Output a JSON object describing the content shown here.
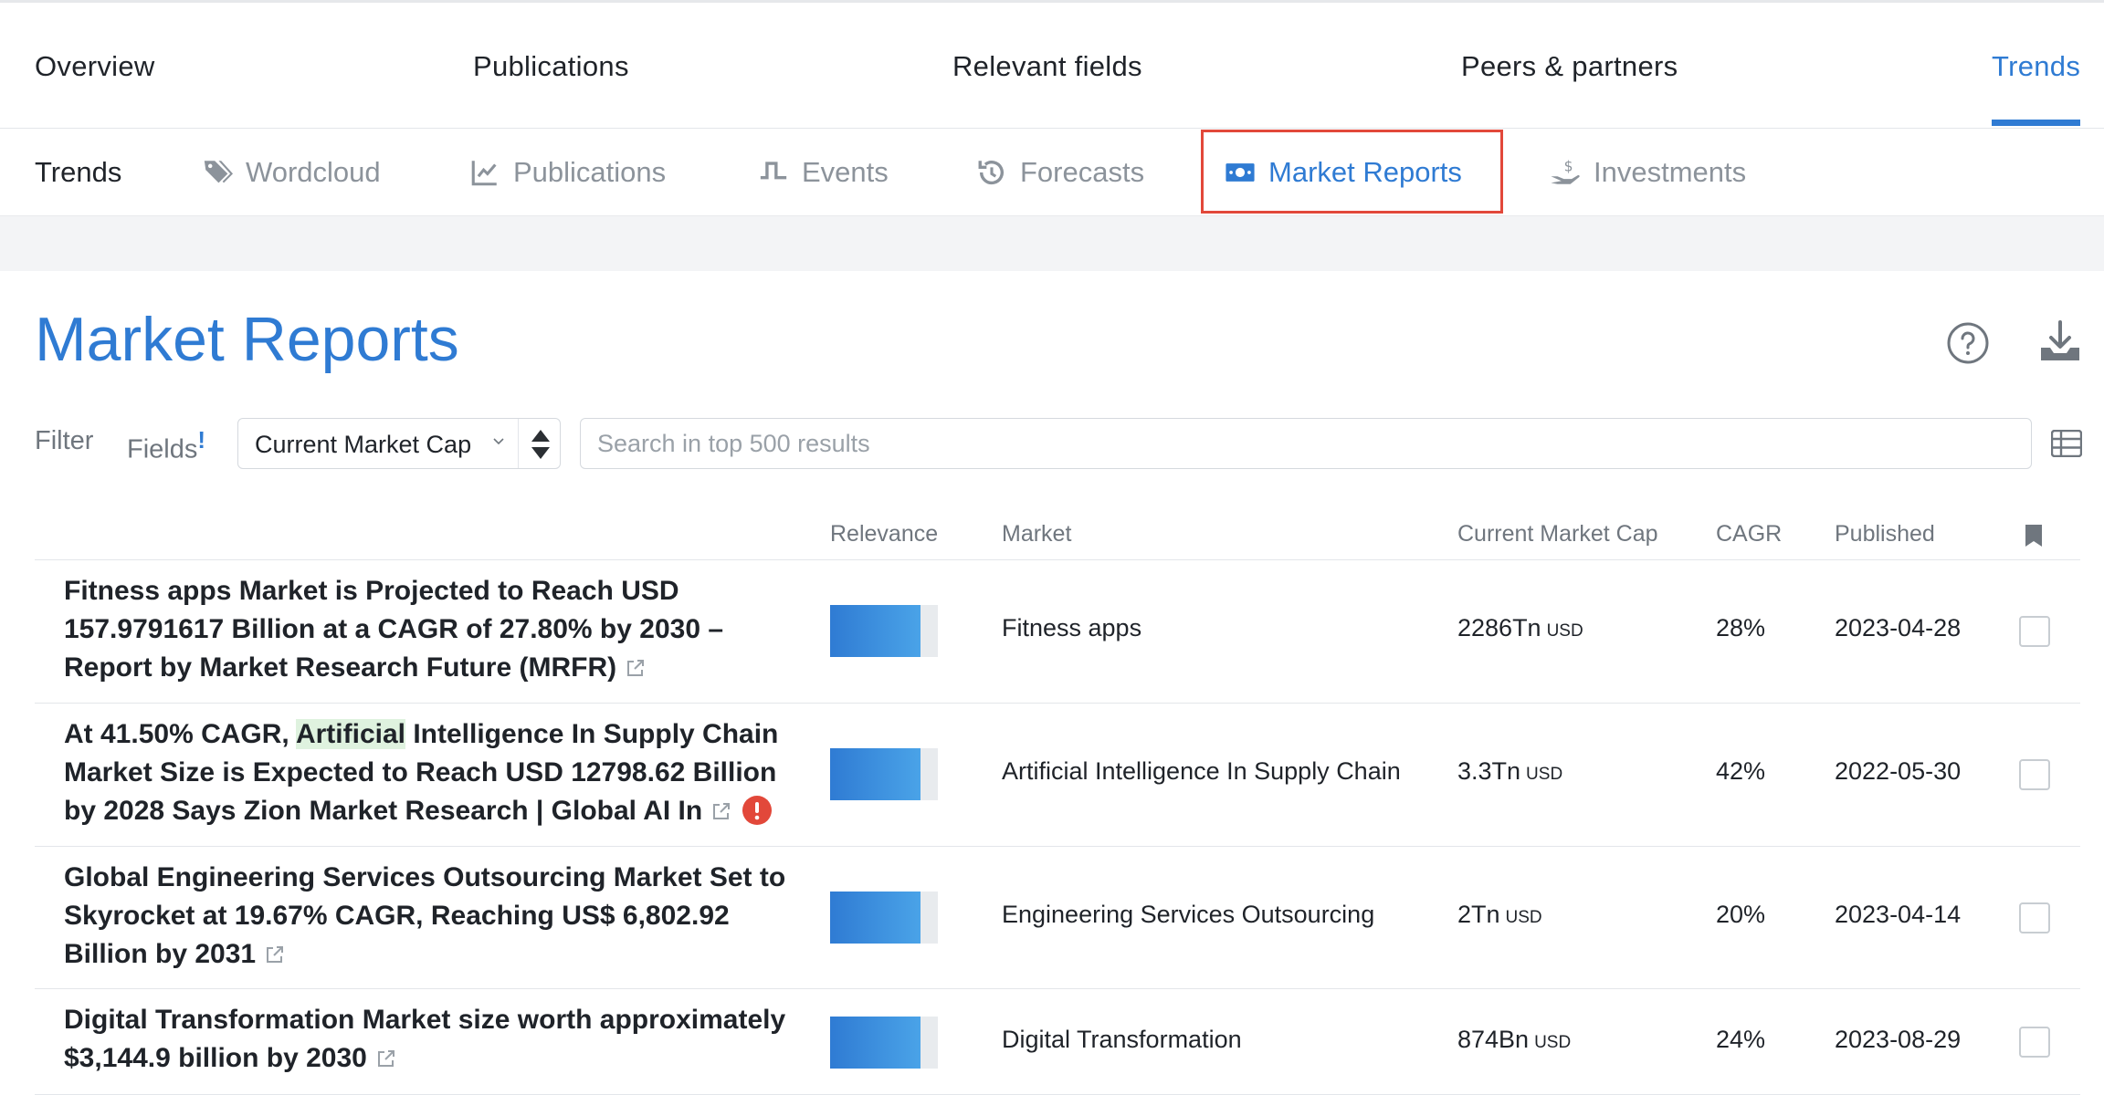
{
  "main_nav": {
    "tabs": [
      {
        "label": "Overview"
      },
      {
        "label": "Publications"
      },
      {
        "label": "Relevant fields"
      },
      {
        "label": "Peers & partners"
      },
      {
        "label": "Trends",
        "active": true
      }
    ]
  },
  "sub_nav": {
    "title": "Trends",
    "items": [
      {
        "label": "Wordcloud",
        "icon": "tag-icon"
      },
      {
        "label": "Publications",
        "icon": "line-chart-icon"
      },
      {
        "label": "Events",
        "icon": "pulse-icon"
      },
      {
        "label": "Forecasts",
        "icon": "history-icon"
      },
      {
        "label": "Market Reports",
        "icon": "money-icon",
        "active": true
      },
      {
        "label": "Investments",
        "icon": "hand-dollar-icon"
      }
    ]
  },
  "page": {
    "title": "Market Reports"
  },
  "filter": {
    "filter_label": "Filter",
    "fields_label": "Fields",
    "fields_badge": "!",
    "sort_select": "Current Market Cap",
    "search_placeholder": "Search in top 500 results"
  },
  "table": {
    "columns": [
      "Relevance",
      "Market",
      "Current Market Cap",
      "CAGR",
      "Published"
    ],
    "rows": [
      {
        "title_parts": [
          "Fitness apps Market is Projected to Reach USD",
          "157.9791617 Billion at a CAGR of 27.80% by 2030 –",
          "Report by Market Research Future (MRFR)"
        ],
        "relevance": 0.84,
        "market": "Fitness apps",
        "market_cap": "2286Tn",
        "unit": "USD",
        "cagr": "28%",
        "published": "2023-04-28",
        "warning": false
      },
      {
        "title_pre": "At 41.50% CAGR, ",
        "title_hl": "Artificial",
        "title_post": " Intelligence In Supply Chain",
        "title_line2": "Market Size is Expected to Reach USD 12798.62 Billion",
        "title_line3": "by 2028 Says Zion Market Research | Global AI In",
        "relevance": 0.84,
        "market": "Artificial Intelligence In Supply Chain",
        "market_cap": "3.3Tn",
        "unit": "USD",
        "cagr": "42%",
        "published": "2022-05-30",
        "warning": true
      },
      {
        "title_parts": [
          "Global Engineering Services Outsourcing Market Set to",
          "Skyrocket at 19.67% CAGR, Reaching US$ 6,802.92",
          "Billion by 2031"
        ],
        "relevance": 0.84,
        "market": "Engineering Services Outsourcing",
        "market_cap": "2Tn",
        "unit": "USD",
        "cagr": "20%",
        "published": "2023-04-14",
        "warning": false
      },
      {
        "title_parts": [
          "Digital Transformation Market size worth approximately",
          "$3,144.9 billion by 2030"
        ],
        "relevance": 0.84,
        "market": "Digital Transformation",
        "market_cap": "874Bn",
        "unit": "USD",
        "cagr": "24%",
        "published": "2023-08-29",
        "warning": false
      }
    ]
  },
  "colors": {
    "accent": "#2f7bd3",
    "highlight_border": "#e2483a",
    "warning": "#e2483a",
    "term_highlight": "#dff2df"
  }
}
